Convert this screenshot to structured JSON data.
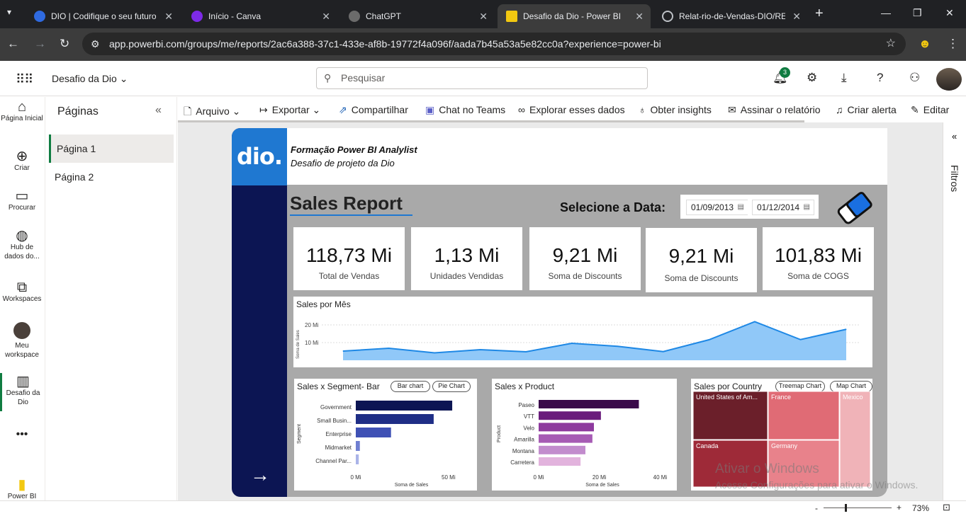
{
  "browser": {
    "tabs": [
      {
        "title": "DIO | Codifique o seu futuro",
        "icon_color": "#2f6ae0"
      },
      {
        "title": "Início - Canva",
        "icon_color": "#7d2ae8"
      },
      {
        "title": "ChatGPT",
        "icon_color": "#6b6b6b"
      },
      {
        "title": "Desafio da Dio - Power BI",
        "icon_color": "#f2c811"
      },
      {
        "title": "Relat-rio-de-Vendas-DIO/RE",
        "icon_color": "#202124"
      }
    ],
    "url": "app.powerbi.com/groups/me/reports/2ac6a388-37c1-433e-af8b-19772f4a096f/aada7b45a53a5e82cc0a?experience=power-bi"
  },
  "header": {
    "workspace_title": "Desafio da Dio",
    "search_placeholder": "Pesquisar",
    "notification_count": "3"
  },
  "leftnav": [
    {
      "label": "Página Inicial",
      "icon": "home-icon"
    },
    {
      "label": "Criar",
      "icon": "plus-icon"
    },
    {
      "label": "Procurar",
      "icon": "folder-icon"
    },
    {
      "label": "Hub de dados do...",
      "icon": "data-hub-icon"
    },
    {
      "label": "Workspaces",
      "icon": "workspaces-icon"
    },
    {
      "label": "Meu workspace",
      "icon": "avatar"
    },
    {
      "label": "Desafio da Dio",
      "icon": "report-icon"
    },
    {
      "label": "Power BI",
      "icon": "powerbi-icon"
    }
  ],
  "pages_pane": {
    "title": "Páginas",
    "pages": [
      "Página 1",
      "Página 2"
    ]
  },
  "toolbar": {
    "arquivo": "Arquivo",
    "exportar": "Exportar",
    "compartilhar": "Compartilhar",
    "chat_teams": "Chat no Teams",
    "explorar": "Explorar esses dados",
    "insights": "Obter insights",
    "assinar": "Assinar o relatório",
    "alerta": "Criar alerta",
    "editar": "Editar"
  },
  "filters_label": "Filtros",
  "zoom": "73%",
  "report": {
    "logo_text": "dio.",
    "subtitle1": "Formação Power BI Analylist",
    "subtitle2": "Desafio de projeto da Dio",
    "title": "Sales Report",
    "select_date_label": "Selecione a Data:",
    "date_start": "01/09/2013",
    "date_end": "01/12/2014",
    "kpis": [
      {
        "value": "118,73 Mi",
        "label": "Total de Vendas"
      },
      {
        "value": "1,13 Mi",
        "label": "Unidades Vendidas"
      },
      {
        "value": "9,21 Mi",
        "label": "Soma de Discounts"
      },
      {
        "value": "9,21 Mi",
        "label": "Soma de Discounts"
      },
      {
        "value": "101,83 Mi",
        "label": "Soma de COGS"
      }
    ],
    "line_chart_title": "Sales por Mês",
    "segment_title": "Sales x Segment- Bar",
    "segment_pill1": "Bar chart",
    "segment_pill2": "Pie Chart",
    "product_title": "Sales x Product",
    "country_title": "Sales por Country",
    "country_pill1": "Treemap Chart",
    "country_pill2": "Map Chart"
  },
  "watermark": {
    "line1": "Ativar o Windows",
    "line2": "Acesse Configurações para ativar o Windows."
  },
  "chart_data": [
    {
      "type": "area",
      "title": "Sales por Mês",
      "xlabel": "",
      "ylabel": "Soma de Sales",
      "yticks": [
        "10 Mi",
        "20 Mi"
      ],
      "ylim": [
        0,
        24
      ],
      "values": [
        5.2,
        6.8,
        4.2,
        6.0,
        4.8,
        9.6,
        7.9,
        4.9,
        11.6,
        21.8,
        11.7,
        17.5
      ],
      "color": "#1e88e5"
    },
    {
      "type": "bar",
      "title": "Sales x Segment- Bar",
      "xlabel": "Soma de Sales",
      "ylabel": "Segment",
      "categories": [
        "Government",
        "Small Busin...",
        "Enterprise",
        "Midmarket",
        "Channel Par..."
      ],
      "values": [
        52,
        42,
        19,
        2.2,
        1.6
      ],
      "xticks": [
        "0 Mi",
        "50 Mi"
      ],
      "xlim": [
        0,
        60
      ],
      "colors": [
        "#0c1553",
        "#1f2e86",
        "#3f51b5",
        "#6f7fd1",
        "#aab4e8"
      ]
    },
    {
      "type": "bar",
      "title": "Sales x Product",
      "xlabel": "Soma de Sales",
      "ylabel": "Product",
      "categories": [
        "Paseo",
        "VTT",
        "Velo",
        "Amarilla",
        "Montana",
        "Carretera"
      ],
      "values": [
        33,
        20.5,
        18.2,
        17.7,
        15.4,
        13.8
      ],
      "xticks": [
        "0 Mi",
        "20 Mi",
        "40 Mi"
      ],
      "xlim": [
        0,
        42
      ],
      "colors": [
        "#3a0a4a",
        "#6a1d7c",
        "#8e3a9e",
        "#a65bb4",
        "#c28ccd",
        "#e2b3dd"
      ]
    },
    {
      "type": "heatmap",
      "title": "Sales por Country",
      "categories": [
        "United States of Am...",
        "France",
        "Mexico",
        "Canada",
        "Germany"
      ],
      "colors": [
        "#6b1f2a",
        "#e06b75",
        "#f0b3b8",
        "#9e2a38",
        "#e8828b"
      ]
    }
  ]
}
